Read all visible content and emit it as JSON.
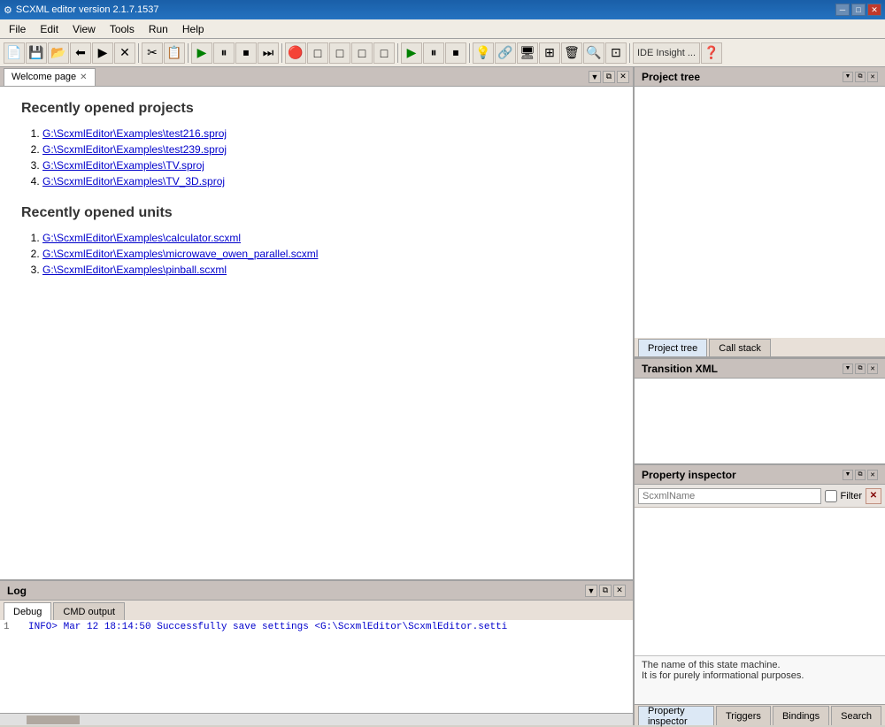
{
  "titleBar": {
    "title": "SCXML editor version 2.1.7.1537",
    "minBtn": "─",
    "maxBtn": "□",
    "closeBtn": "✕"
  },
  "menuBar": {
    "items": [
      "File",
      "Edit",
      "View",
      "Tools",
      "Run",
      "Help"
    ]
  },
  "toolbar": {
    "ideLabel": "IDE Insight ...",
    "buttons": [
      "📄",
      "💾",
      "📂",
      "⬅",
      "▶",
      "✕",
      "■",
      "■",
      "▶",
      "⏸",
      "⏹",
      "⏭",
      "🔴",
      "□",
      "□",
      "□",
      "□",
      "▶",
      "⏸",
      "⏹",
      "💡",
      "🔗",
      "🔧",
      "🖥",
      "⊞",
      "🗑",
      "🔍",
      "⊡",
      "❓"
    ]
  },
  "welcomePage": {
    "tabLabel": "Welcome page",
    "recentProjectsTitle": "Recently opened projects",
    "recentProjects": [
      "G:\\ScxmlEditor\\Examples\\test216.sproj",
      "G:\\ScxmlEditor\\Examples\\test239.sproj",
      "G:\\ScxmlEditor\\Examples\\TV.sproj",
      "G:\\ScxmlEditor\\Examples\\TV_3D.sproj"
    ],
    "recentUnitsTitle": "Recently opened units",
    "recentUnits": [
      "G:\\ScxmlEditor\\Examples\\calculator.scxml",
      "G:\\ScxmlEditor\\Examples\\microwave_owen_parallel.scxml",
      "G:\\ScxmlEditor\\Examples\\pinball.scxml"
    ]
  },
  "projectTree": {
    "header": "Project tree",
    "tabs": [
      "Project tree",
      "Call stack"
    ]
  },
  "transitionXml": {
    "header": "Transition XML"
  },
  "propertyInspector": {
    "header": "Property inspector",
    "filterPlaceholder": "ScxmlName",
    "filterLabel": "Filter",
    "description": {
      "line1": "The name of this state machine.",
      "line2": "It is for purely informational purposes."
    },
    "bottomTabs": [
      "Property inspector",
      "Triggers",
      "Bindings",
      "Search"
    ]
  },
  "log": {
    "header": "Log",
    "tabs": [
      "Debug",
      "CMD output"
    ],
    "entries": [
      {
        "num": "1",
        "text": "INFO> Mar 12 18:14:50 Successfully save settings <G:\\ScxmlEditor\\ScxmlEditor.setti"
      }
    ]
  }
}
